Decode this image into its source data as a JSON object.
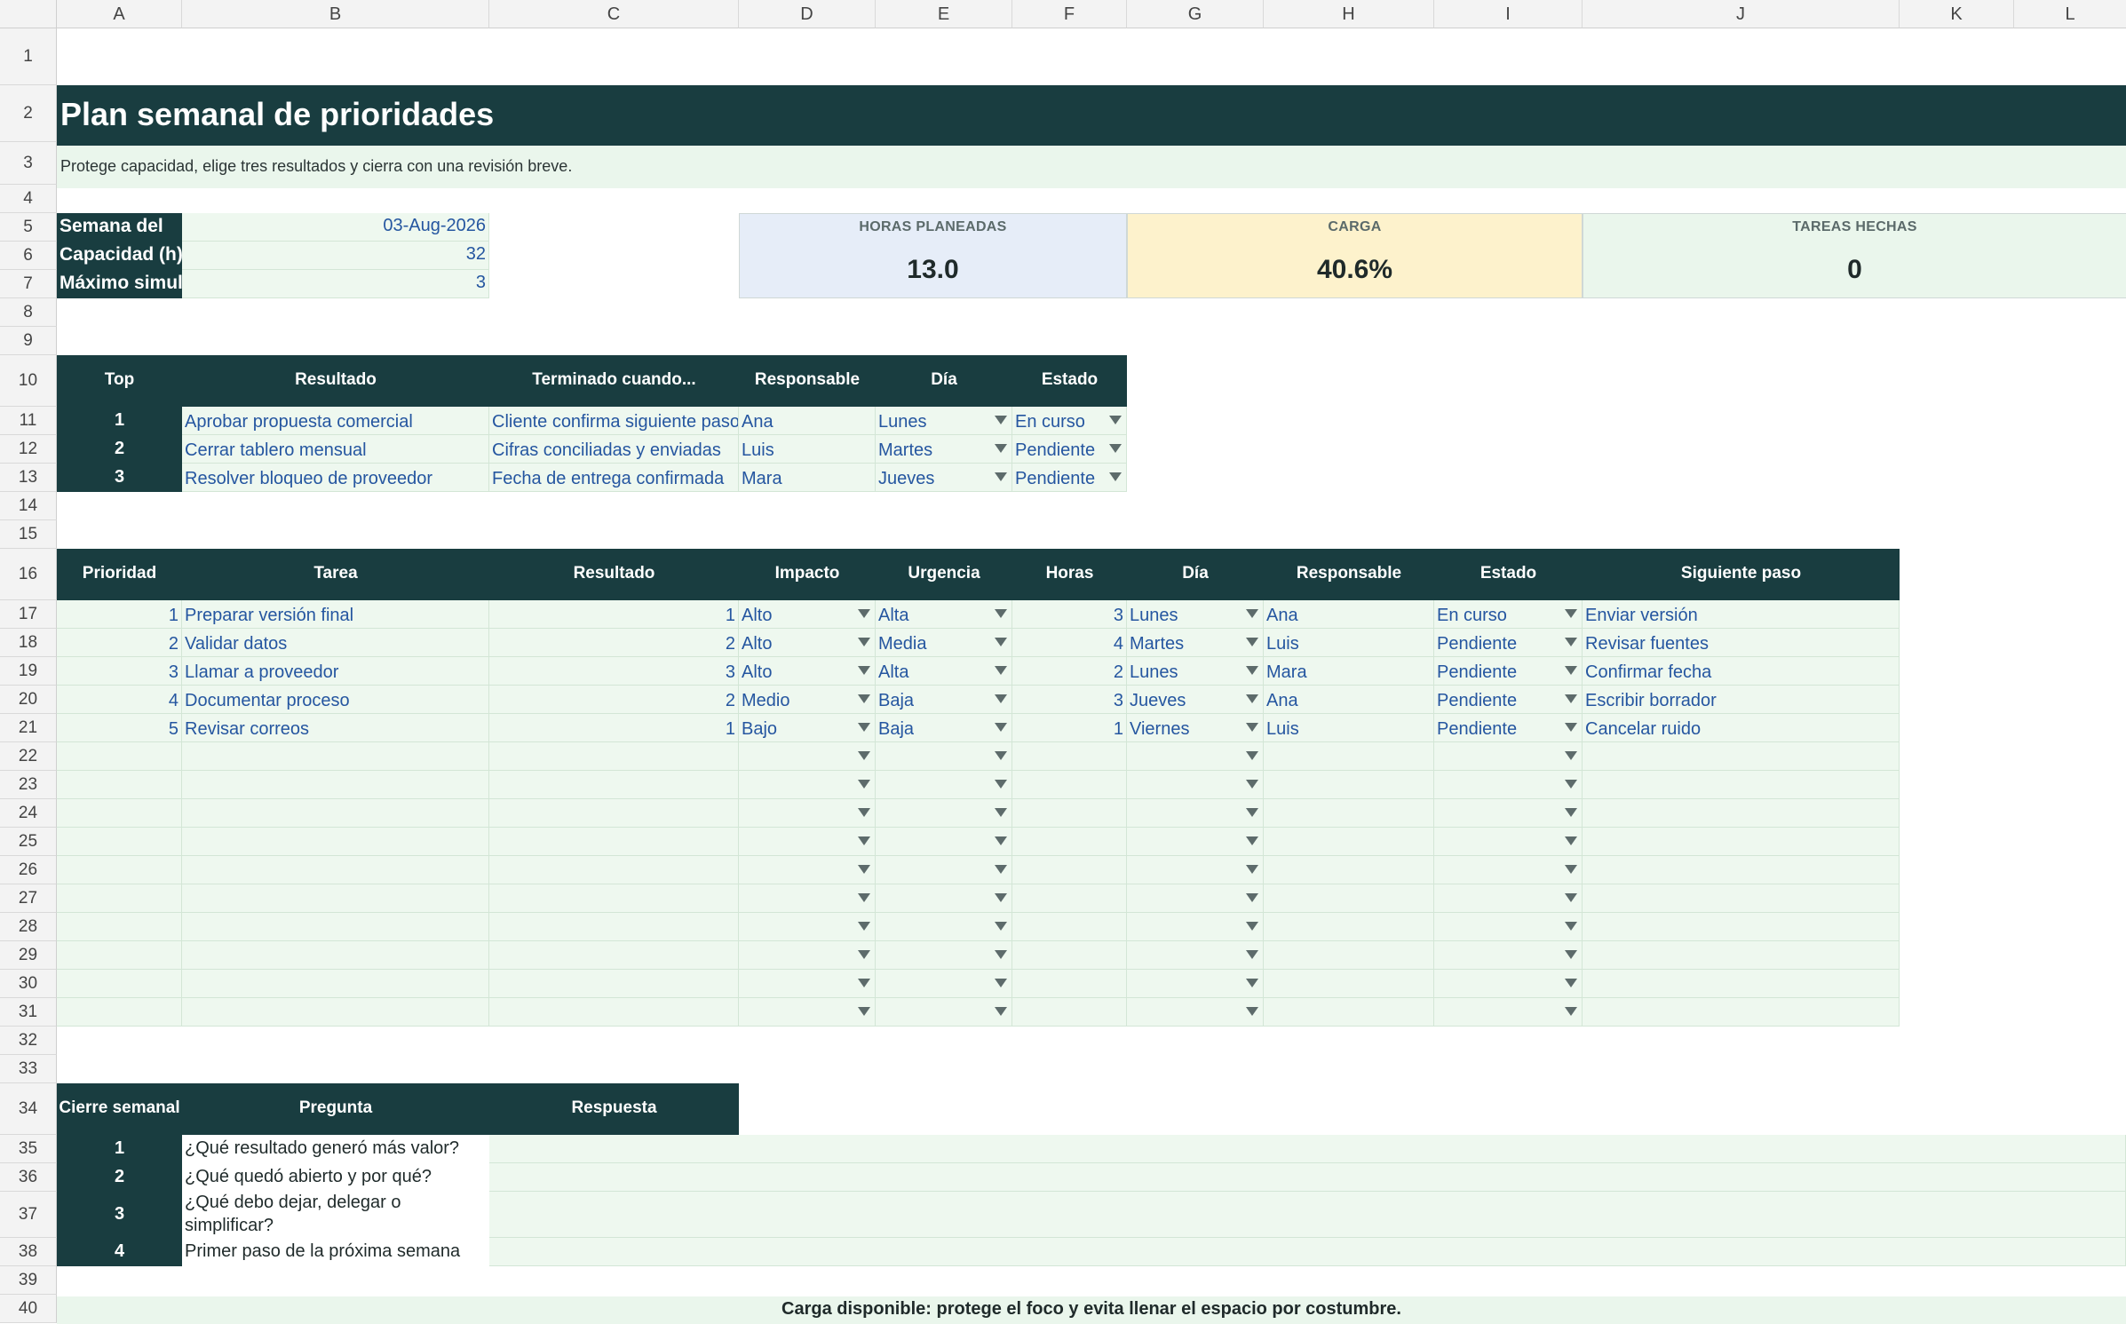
{
  "columns": [
    "A",
    "B",
    "C",
    "D",
    "E",
    "F",
    "G",
    "H",
    "I",
    "J",
    "K",
    "L"
  ],
  "rows": [
    "1",
    "2",
    "3",
    "4",
    "5",
    "6",
    "7",
    "8",
    "9",
    "10",
    "11",
    "12",
    "13",
    "14",
    "15",
    "16",
    "17",
    "18",
    "19",
    "20",
    "21",
    "22",
    "23",
    "24",
    "25",
    "26",
    "27",
    "28",
    "29",
    "30",
    "31",
    "32",
    "33",
    "34",
    "35",
    "36",
    "37",
    "38",
    "39",
    "40"
  ],
  "title": "Plan semanal de prioridades",
  "subtitle": "Protege capacidad, elige tres resultados y cierra con una revisión breve.",
  "settings": [
    {
      "label": "Semana del",
      "value": "03-Aug-2026"
    },
    {
      "label": "Capacidad (h)",
      "value": "32"
    },
    {
      "label": "Máximo simult",
      "value": "3"
    }
  ],
  "kpis": [
    {
      "label": "HORAS PLANEADAS",
      "value": "13.0",
      "color": "#e6edf8"
    },
    {
      "label": "CARGA",
      "value": "40.6%",
      "color": "#fdf2cc"
    },
    {
      "label": "TAREAS HECHAS",
      "value": "0",
      "color": "#eaf6ec"
    }
  ],
  "top_table": {
    "headers": [
      "Top",
      "Resultado",
      "Terminado cuando...",
      "Responsable",
      "Día",
      "Estado"
    ],
    "rows": [
      [
        "1",
        "Aprobar propuesta comercial",
        "Cliente confirma siguiente paso",
        "Ana",
        "Lunes",
        "En curso"
      ],
      [
        "2",
        "Cerrar tablero mensual",
        "Cifras conciliadas y enviadas",
        "Luis",
        "Martes",
        "Pendiente"
      ],
      [
        "3",
        "Resolver bloqueo de proveedor",
        "Fecha de entrega confirmada",
        "Mara",
        "Jueves",
        "Pendiente"
      ]
    ]
  },
  "task_table": {
    "headers": [
      "Prioridad",
      "Tarea",
      "Resultado",
      "Impacto",
      "Urgencia",
      "Horas",
      "Día",
      "Responsable",
      "Estado",
      "Siguiente paso"
    ],
    "rows": [
      [
        "1",
        "Preparar versión final",
        "1",
        "Alto",
        "Alta",
        "3",
        "Lunes",
        "Ana",
        "En curso",
        "Enviar versión"
      ],
      [
        "2",
        "Validar datos",
        "2",
        "Alto",
        "Media",
        "4",
        "Martes",
        "Luis",
        "Pendiente",
        "Revisar fuentes"
      ],
      [
        "3",
        "Llamar a proveedor",
        "3",
        "Alto",
        "Alta",
        "2",
        "Lunes",
        "Mara",
        "Pendiente",
        "Confirmar fecha"
      ],
      [
        "4",
        "Documentar proceso",
        "2",
        "Medio",
        "Baja",
        "3",
        "Jueves",
        "Ana",
        "Pendiente",
        "Escribir borrador"
      ],
      [
        "5",
        "Revisar correos",
        "1",
        "Bajo",
        "Baja",
        "1",
        "Viernes",
        "Luis",
        "Pendiente",
        "Cancelar ruido"
      ]
    ],
    "empty_rows": 10
  },
  "review_table": {
    "headers": [
      "Cierre semanal",
      "Pregunta",
      "Respuesta"
    ],
    "rows": [
      [
        "1",
        "¿Qué resultado generó más valor?"
      ],
      [
        "2",
        "¿Qué quedó abierto y por qué?"
      ],
      [
        "3",
        "¿Qué debo dejar, delegar o simplificar?"
      ],
      [
        "4",
        "Primer paso de la próxima semana"
      ]
    ]
  },
  "footer": "Carga disponible: protege el foco y evita llenar el espacio por costumbre."
}
